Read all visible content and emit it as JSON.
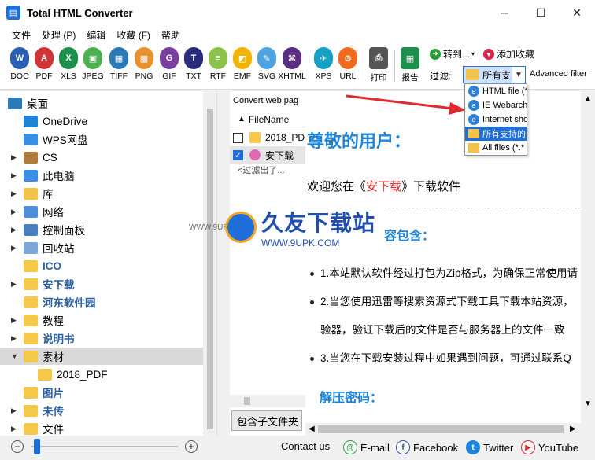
{
  "window": {
    "title": "Total HTML Converter",
    "icon": "converter-app-icon",
    "controls": [
      "─",
      "☐",
      "✕"
    ]
  },
  "menu": [
    "文件",
    "处理 (P)",
    "编辑",
    "收藏 (F)",
    "帮助"
  ],
  "toolbar": {
    "buttons": [
      {
        "label": "DOC",
        "color": "#2b5fb4",
        "glyph": "W"
      },
      {
        "label": "PDF",
        "color": "#d13438",
        "glyph": "A"
      },
      {
        "label": "XLS",
        "color": "#1f8f4d",
        "glyph": "X"
      },
      {
        "label": "JPEG",
        "color": "#4caf50",
        "glyph": "▣"
      },
      {
        "label": "TIFF",
        "color": "#2a7ab8",
        "glyph": "▦"
      },
      {
        "label": "PNG",
        "color": "#e8912d",
        "glyph": "▩"
      },
      {
        "label": "GIF",
        "color": "#7b3fa0",
        "glyph": "G"
      },
      {
        "label": "TXT",
        "color": "#2a2a7a",
        "glyph": "T"
      },
      {
        "label": "RTF",
        "color": "#8bc34a",
        "glyph": "≡"
      },
      {
        "label": "EMF",
        "color": "#f0b400",
        "glyph": "◩"
      },
      {
        "label": "SVG",
        "color": "#4fa3e0",
        "glyph": "✎"
      },
      {
        "label": "XHTML",
        "color": "#5a2d82",
        "glyph": "⌘"
      },
      {
        "label": "XPS",
        "color": "#16a0c4",
        "glyph": "✈"
      },
      {
        "label": "URL",
        "color": "#f06a20",
        "glyph": "⚙"
      }
    ],
    "print_label": "打印",
    "report_label": "报告",
    "goto_label": "转到...",
    "add_fav_label": "添加收藏",
    "filter_label": "过滤:",
    "filter_value": "所有支",
    "advanced_filter_label": "Advanced filter"
  },
  "filter_dropdown": {
    "options": [
      {
        "label": "HTML file (*",
        "icon": "ie-icon",
        "selected": false
      },
      {
        "label": "IE Webarch",
        "icon": "ie-icon",
        "selected": false
      },
      {
        "label": "Internet sho",
        "icon": "ie-icon",
        "selected": false
      },
      {
        "label": "所有支持的",
        "icon": "folder-icon",
        "selected": true
      },
      {
        "label": "All files (*.*",
        "icon": "files-icon",
        "selected": false
      }
    ]
  },
  "tree": {
    "items": [
      {
        "label": "桌面",
        "indent": 0,
        "expander": "",
        "icon": "desktop-icon",
        "selected": false,
        "bold": false
      },
      {
        "label": "OneDrive",
        "indent": 1,
        "expander": "",
        "icon": "cloud-icon",
        "selected": false,
        "bold": false
      },
      {
        "label": "WPS网盘",
        "indent": 1,
        "expander": "",
        "icon": "wps-cloud-icon",
        "selected": false,
        "bold": false
      },
      {
        "label": "CS",
        "indent": 1,
        "expander": "▶",
        "icon": "user-icon",
        "selected": false,
        "bold": false
      },
      {
        "label": "此电脑",
        "indent": 1,
        "expander": "▶",
        "icon": "computer-icon",
        "selected": false,
        "bold": false
      },
      {
        "label": "库",
        "indent": 1,
        "expander": "▶",
        "icon": "library-icon",
        "selected": false,
        "bold": false
      },
      {
        "label": "网络",
        "indent": 1,
        "expander": "▶",
        "icon": "network-icon",
        "selected": false,
        "bold": false
      },
      {
        "label": "控制面板",
        "indent": 1,
        "expander": "▶",
        "icon": "control-panel-icon",
        "selected": false,
        "bold": false
      },
      {
        "label": "回收站",
        "indent": 1,
        "expander": "▶",
        "icon": "recycle-bin-icon",
        "selected": false,
        "bold": false
      },
      {
        "label": "ICO",
        "indent": 1,
        "expander": "",
        "icon": "folder-icon",
        "selected": false,
        "bold": true
      },
      {
        "label": "安下载",
        "indent": 1,
        "expander": "▶",
        "icon": "folder-icon",
        "selected": false,
        "bold": true
      },
      {
        "label": "河东软件园",
        "indent": 1,
        "expander": "",
        "icon": "folder-icon",
        "selected": false,
        "bold": true
      },
      {
        "label": "教程",
        "indent": 1,
        "expander": "▶",
        "icon": "folder-icon",
        "selected": false,
        "bold": false
      },
      {
        "label": "说明书",
        "indent": 1,
        "expander": "▶",
        "icon": "folder-icon",
        "selected": false,
        "bold": true
      },
      {
        "label": "素材",
        "indent": 1,
        "expander": "▼",
        "icon": "folder-icon",
        "selected": true,
        "bold": false
      },
      {
        "label": "2018_PDF",
        "indent": 2,
        "expander": "",
        "icon": "folder-icon",
        "selected": false,
        "bold": false
      },
      {
        "label": "图片",
        "indent": 1,
        "expander": "",
        "icon": "folder-icon",
        "selected": false,
        "bold": true
      },
      {
        "label": "未传",
        "indent": 1,
        "expander": "▶",
        "icon": "folder-icon",
        "selected": false,
        "bold": true
      },
      {
        "label": "文件",
        "indent": 1,
        "expander": "▶",
        "icon": "folder-icon",
        "selected": false,
        "bold": false
      }
    ]
  },
  "filepane": {
    "tab_label": "Convert web pag",
    "column_header": "FileName",
    "rows": [
      {
        "name": "2018_PD",
        "checked": false,
        "icon": "folder-icon"
      },
      {
        "name": "安下载",
        "checked": true,
        "icon": "html-file-icon"
      }
    ],
    "filter_note": "<过滤出了...",
    "include_subfolders_label": "包含子文件夹"
  },
  "preview": {
    "heading": "尊敬的用户：",
    "welcome_prefix": "欢迎您在《",
    "welcome_highlight": "安下载",
    "welcome_suffix": "》下载软件",
    "subheading": "容包含：",
    "bullets": [
      "1.本站默认软件经过打包为Zip格式，为确保正常使用请",
      "2.当您使用迅雷等搜索资源式下载工具下载本站资源，",
      "验器，验证下载后的文件是否与服务器上的文件一致",
      "3.当您在下载安装过程中如果遇到问题，可通过联系Q"
    ],
    "password_heading": "解压密码："
  },
  "watermark": {
    "title": "久友下载站",
    "url": "WWW.9UPK.COM",
    "left_text": "WWW.9UPK.COM"
  },
  "statusbar": {
    "zoom_minus": "−",
    "zoom_plus": "+",
    "contact_label": "Contact us",
    "email_label": "E-mail",
    "facebook_label": "Facebook",
    "twitter_label": "Twitter",
    "youtube_label": "YouTube",
    "colors": {
      "email": "#2a9d3a",
      "facebook": "#2a4f9a",
      "twitter": "#1e84d8",
      "youtube": "#d9252a"
    }
  }
}
